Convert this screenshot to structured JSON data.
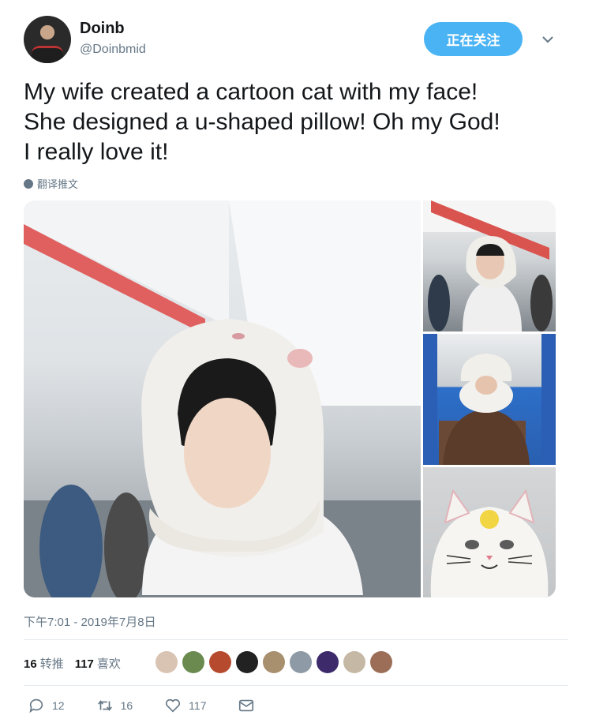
{
  "user": {
    "name": "Doinb",
    "handle": "@Doinbmid"
  },
  "follow_button": {
    "label": "正在关注"
  },
  "tweet": {
    "text": "My wife created a cartoon cat with my face!\nShe designed a u-shaped pillow! Oh my God!\nI really love it!",
    "translate_label": "翻译推文",
    "timestamp": "下午7:01 - 2019年7月8日"
  },
  "stats": {
    "retweets": "16",
    "retweets_label": "转推",
    "likes": "117",
    "likes_label": "喜欢"
  },
  "likers": [
    {
      "color": "#d9c3b2"
    },
    {
      "color": "#6b8a4f"
    },
    {
      "color": "#b54a2f"
    },
    {
      "color": "#222222"
    },
    {
      "color": "#a88f6e"
    },
    {
      "color": "#8e9aa6"
    },
    {
      "color": "#3c2a6b"
    },
    {
      "color": "#c5b9a5"
    },
    {
      "color": "#9c6e58"
    }
  ],
  "actions": {
    "reply_count": "12",
    "retweet_count": "16",
    "like_count": "117"
  },
  "icons": {
    "reply": "reply-icon",
    "retweet": "retweet-icon",
    "like": "heart-icon",
    "dm": "envelope-icon",
    "more": "chevron-down-icon"
  },
  "colors": {
    "accent": "#4ab3f4",
    "muted": "#657786",
    "text": "#14171a"
  }
}
